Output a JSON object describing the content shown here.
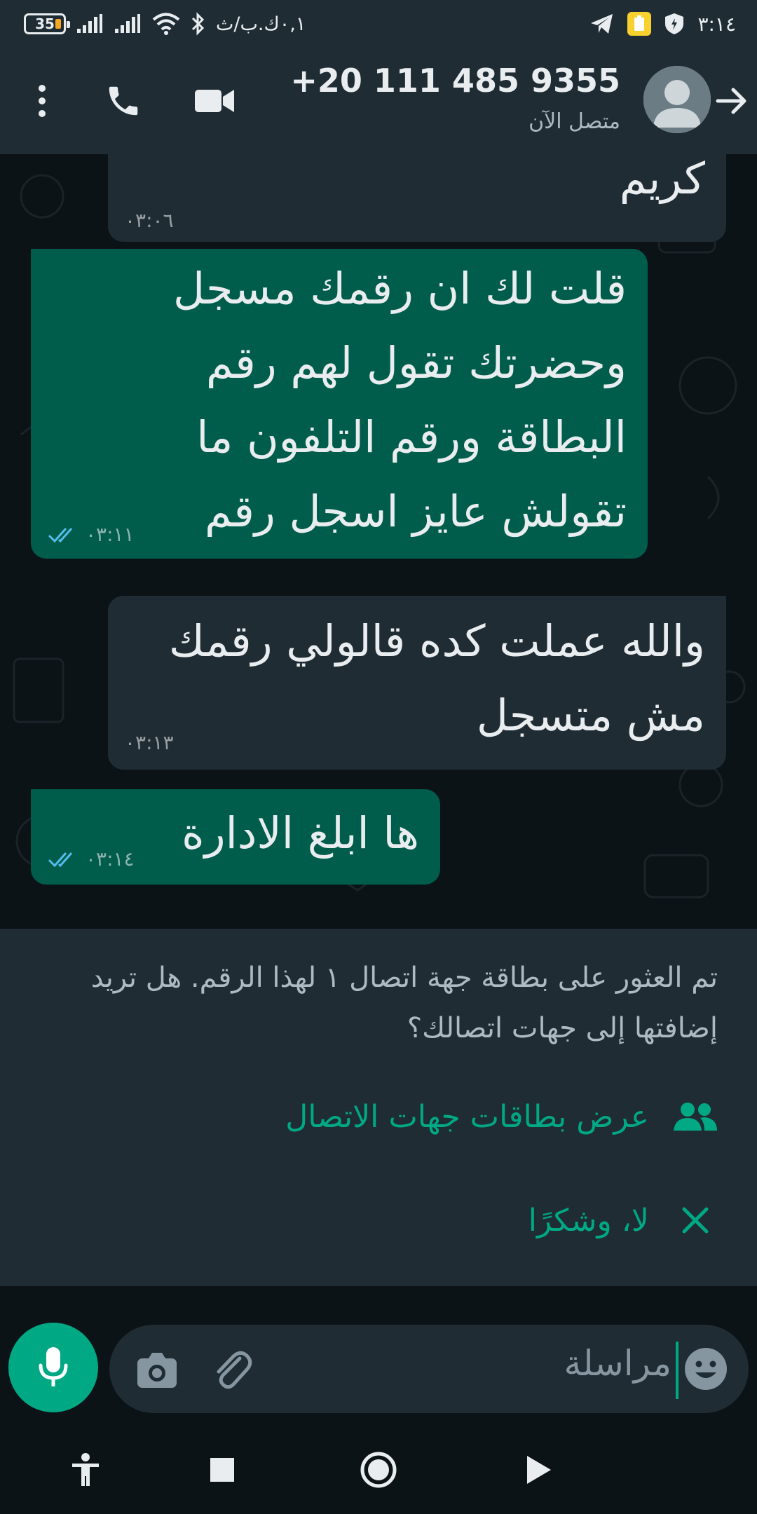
{
  "status_bar": {
    "battery": "35",
    "carrier_text": "٠,١ك.ب/ث",
    "clock": "٣:١٤",
    "icons": [
      "battery-icon",
      "signal-icon",
      "signal-icon",
      "wifi-icon",
      "bluetooth-icon",
      "telegram-icon",
      "notification-icon",
      "shield-icon"
    ]
  },
  "header": {
    "contact_name": "+20 111 485 9355",
    "status": "متصل الآن",
    "icons": [
      "back-arrow-icon",
      "avatar-icon",
      "video-call-icon",
      "phone-call-icon",
      "more-options-icon"
    ]
  },
  "messages": [
    {
      "direction": "incoming",
      "lines": [
        "كريم"
      ],
      "time": "٠٣:٠٦"
    },
    {
      "direction": "outgoing",
      "lines": [
        "قلت لك ان رقمك مسجل",
        "وحضرتك تقول لهم رقم",
        "البطاقة ورقم التلفون ما",
        "تقولش عايز اسجل رقم"
      ],
      "time": "٠٣:١١",
      "status": "read"
    },
    {
      "direction": "incoming",
      "lines": [
        "والله عملت كده قالولي رقمك",
        "مش متسجل"
      ],
      "time": "٠٣:١٣"
    },
    {
      "direction": "outgoing",
      "lines": [
        "ها ابلغ الادارة"
      ],
      "time": "٠٣:١٤",
      "status": "read"
    }
  ],
  "contact_banner": {
    "text": "تم العثور على بطاقة جهة اتصال ١ لهذا الرقم. هل تريد إضافتها إلى جهات اتصالك؟",
    "view_action": "عرض بطاقات جهات الاتصال",
    "dismiss_action": "لا، وشكرًا"
  },
  "input": {
    "placeholder": "مراسلة"
  },
  "colors": {
    "accent": "#00a884",
    "outgoing_bubble": "#005c4b",
    "incoming_bubble": "#202c33",
    "header": "#1f2c34",
    "read_ticks": "#53bdeb"
  }
}
